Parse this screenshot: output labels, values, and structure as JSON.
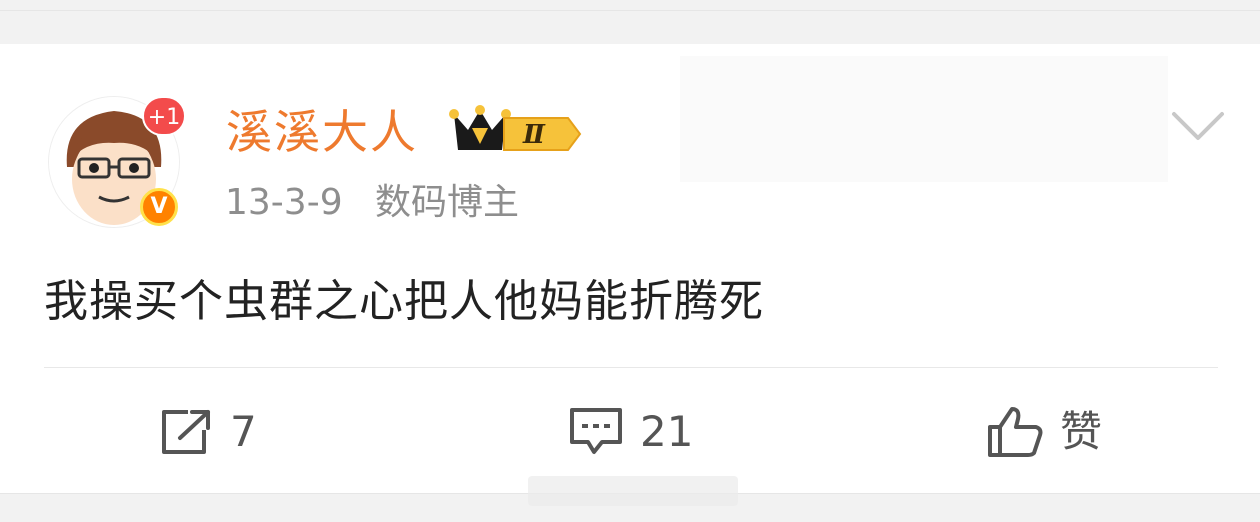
{
  "post": {
    "user": {
      "name": "溪溪大人",
      "notification_badge": "+1",
      "verified_badge": "V",
      "member_level": "Ⅱ",
      "name_color": "#ee7a2e"
    },
    "date": "13-3-9",
    "source": "数码博主",
    "text": "我操买个虫群之心把人他妈能折腾死"
  },
  "actions": {
    "repost_count": "7",
    "comment_count": "21",
    "like_label": "赞"
  },
  "icons": {
    "repost": "share-box-icon",
    "comment": "comment-bubble-icon",
    "like": "thumbs-up-icon",
    "menu": "chevron-down-icon"
  },
  "colors": {
    "accent": "#ee7a2e",
    "badge_red": "#f34b4b",
    "verified_orange": "#ff8200",
    "text_gray": "#8e8e8e"
  }
}
